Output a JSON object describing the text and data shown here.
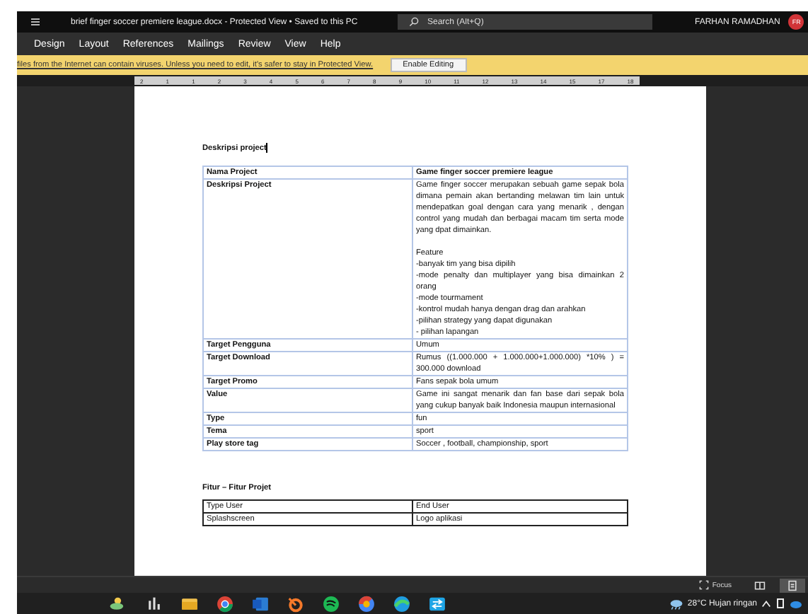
{
  "window": {
    "title": "brief finger soccer premiere league.docx  -  Protected View • Saved to this PC",
    "search": {
      "placeholder": "Search (Alt+Q)"
    },
    "user": {
      "name": "FARHAN RAMADHAN",
      "initials": "FR"
    }
  },
  "ribbon_tabs": [
    "Design",
    "Layout",
    "References",
    "Mailings",
    "Review",
    "View",
    "Help"
  ],
  "protected_bar": {
    "message": "files from the Internet can contain viruses. Unless you need to edit, it's safer to stay in Protected View.",
    "button": "Enable Editing"
  },
  "ruler": [
    "2",
    "1",
    "1",
    "2",
    "3",
    "4",
    "5",
    "6",
    "7",
    "8",
    "9",
    "10",
    "11",
    "12",
    "13",
    "14",
    "15",
    "17",
    "18"
  ],
  "document": {
    "heading": "Deskripsi project",
    "table": [
      {
        "label": "Nama Project",
        "value": [
          "Game finger soccer premiere league"
        ],
        "kind": "header"
      },
      {
        "label": "Deskripsi Project",
        "value": [
          "Game finger soccer  merupakan sebuah game sepak bola  dimana pemain akan bertanding melawan  tim lain  untuk mendepatkan goal dengan cara yang menarik , dengan control yang mudah dan berbagai macam tim serta mode yang dpat dimainkan."
        ],
        "kind": "row",
        "extra": [
          "Feature",
          "-banyak tim yang bisa dipilih",
          "-mode penalty dan multiplayer yang   bisa dimainkan 2 orang",
          "-mode tourmament",
          "-kontrol mudah hanya dengan drag dan arahkan",
          "-pilihan strategy yang dapat digunakan",
          "- pilihan lapangan"
        ]
      },
      {
        "label": "Target Pengguna",
        "value": [
          "Umum"
        ],
        "kind": "row"
      },
      {
        "label": "Target Download",
        "value": [
          "Rumus  ((1.000.000  +  1.000.000+1.000.000) *10% ) = 300.000 download"
        ],
        "kind": "row"
      },
      {
        "label": "Target Promo",
        "value": [
          "Fans sepak bola  umum"
        ],
        "kind": "row"
      },
      {
        "label": "Value",
        "value": [
          "Game ini sangat menarik dan fan base dari sepak bola yang cukup banyak baik Indonesia maupun internasional"
        ],
        "kind": "row"
      },
      {
        "label": "Type",
        "value": [
          "fun"
        ],
        "kind": "row"
      },
      {
        "label": "Tema",
        "value": [
          "sport"
        ],
        "kind": "row"
      },
      {
        "label": "Play store tag",
        "value": [
          "Soccer , football, championship, sport"
        ],
        "kind": "row"
      }
    ],
    "heading_2": "Fitur – Fitur  Projet",
    "table_2": [
      [
        "Type  User",
        "End User"
      ],
      [
        "Splashscreen",
        "Logo aplikasi"
      ]
    ]
  },
  "status_bar": {
    "focus": "Focus",
    "views": [
      {
        "selected": false
      },
      {
        "selected": true
      }
    ]
  },
  "taskbar": {
    "weather": "28°C  Hujan ringan"
  }
}
